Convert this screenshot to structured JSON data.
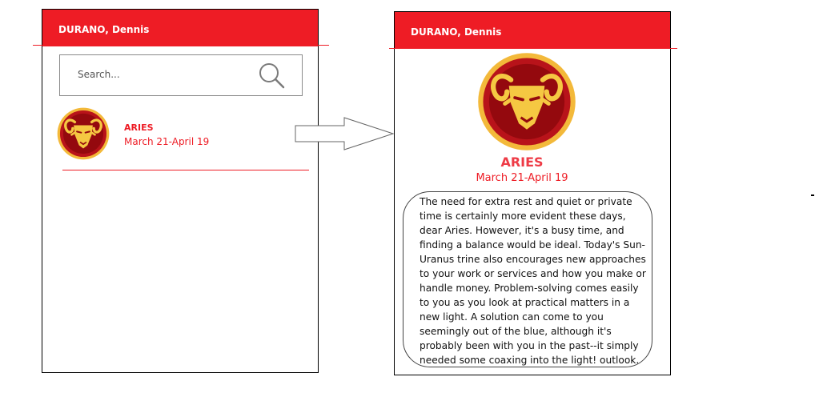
{
  "left_screen": {
    "header": {
      "title": "DURANO, Dennis"
    },
    "search": {
      "placeholder": "Search..."
    },
    "results": [
      {
        "icon": "aries-sign-icon",
        "name": "ARIES",
        "dates": "March 21-April 19"
      }
    ]
  },
  "right_screen": {
    "header": {
      "title": "DURANO, Dennis"
    },
    "sign": {
      "icon": "aries-sign-icon",
      "name": "ARIES",
      "dates": "March 21-April 19"
    },
    "horoscope": {
      "text": "The need for extra rest and quiet or private time is certainly more evident these days, dear Aries. However, it's a busy time, and finding a balance would be ideal. Today's Sun-Uranus trine also encourages new approaches to your work or services and how you make or handle money. Problem-solving comes easily to you as you look at practical matters in a new light. A solution can come to you seemingly out of the blue, although it's probably been with you in the past--it simply needed some coaxing into the light! outlook.",
      "overflow_text": "     "
    }
  },
  "colors": {
    "brand_red": "#ee1c25",
    "logo_gold": "#f5c842",
    "logo_maroon": "#9e0b10"
  },
  "flow_arrow": {
    "icon": "right-arrow-icon"
  }
}
